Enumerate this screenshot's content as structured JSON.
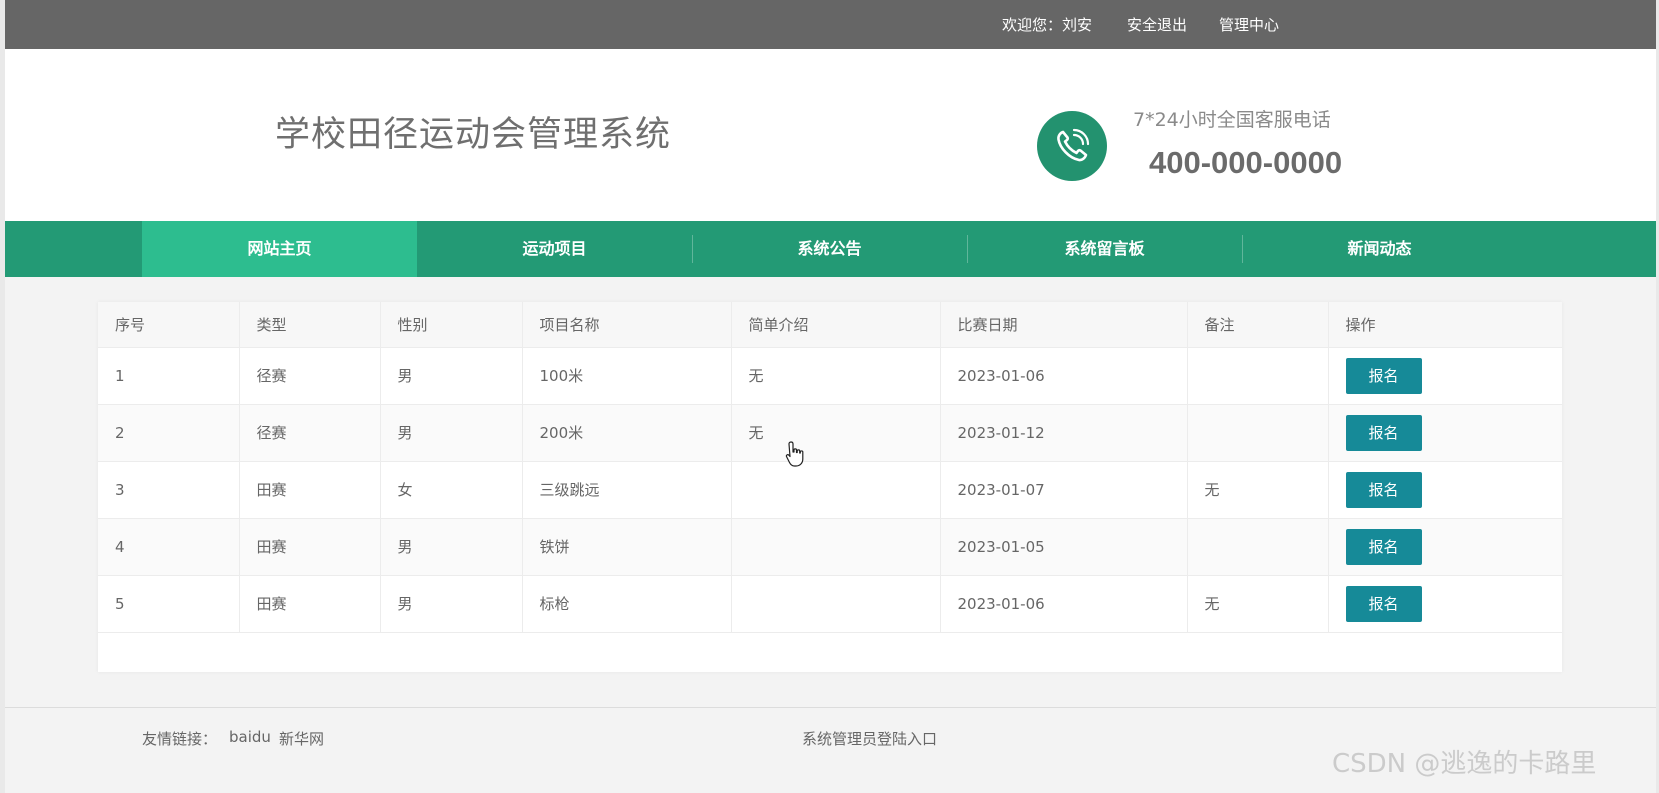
{
  "topbar": {
    "welcome": "欢迎您：刘安",
    "logout": "安全退出",
    "admin_center": "管理中心"
  },
  "header": {
    "title": "学校田径运动会管理系统",
    "hotline_label": "7*24小时全国客服电话",
    "hotline_number": "400-000-0000",
    "phone_icon": "phone-icon"
  },
  "nav": {
    "items": [
      "网站主页",
      "运动项目",
      "系统公告",
      "系统留言板",
      "新闻动态"
    ],
    "active_index": 0
  },
  "table": {
    "headers": [
      "序号",
      "类型",
      "性别",
      "项目名称",
      "简单介绍",
      "比赛日期",
      "备注",
      "操作"
    ],
    "rows": [
      [
        "1",
        "径赛",
        "男",
        "100米",
        "无",
        "2023-01-06",
        "",
        "报名"
      ],
      [
        "2",
        "径赛",
        "男",
        "200米",
        "无",
        "2023-01-12",
        "",
        "报名"
      ],
      [
        "3",
        "田赛",
        "女",
        "三级跳远",
        "",
        "2023-01-07",
        "无",
        "报名"
      ],
      [
        "4",
        "田赛",
        "男",
        "铁饼",
        "",
        "2023-01-05",
        "",
        "报名"
      ],
      [
        "5",
        "田赛",
        "男",
        "标枪",
        "",
        "2023-01-06",
        "无",
        "报名"
      ]
    ]
  },
  "footer": {
    "links_label": "友情链接：",
    "link_1": "baidu",
    "link_2": "新华网",
    "admin_login": "系统管理员登陆入口"
  },
  "watermark": "CSDN @逃逸的卡路里",
  "colors": {
    "topbar": "#666666",
    "nav": "#239a75",
    "nav_active": "#2dbd8f",
    "button": "#168a98",
    "phone_circle": "#23926f"
  }
}
